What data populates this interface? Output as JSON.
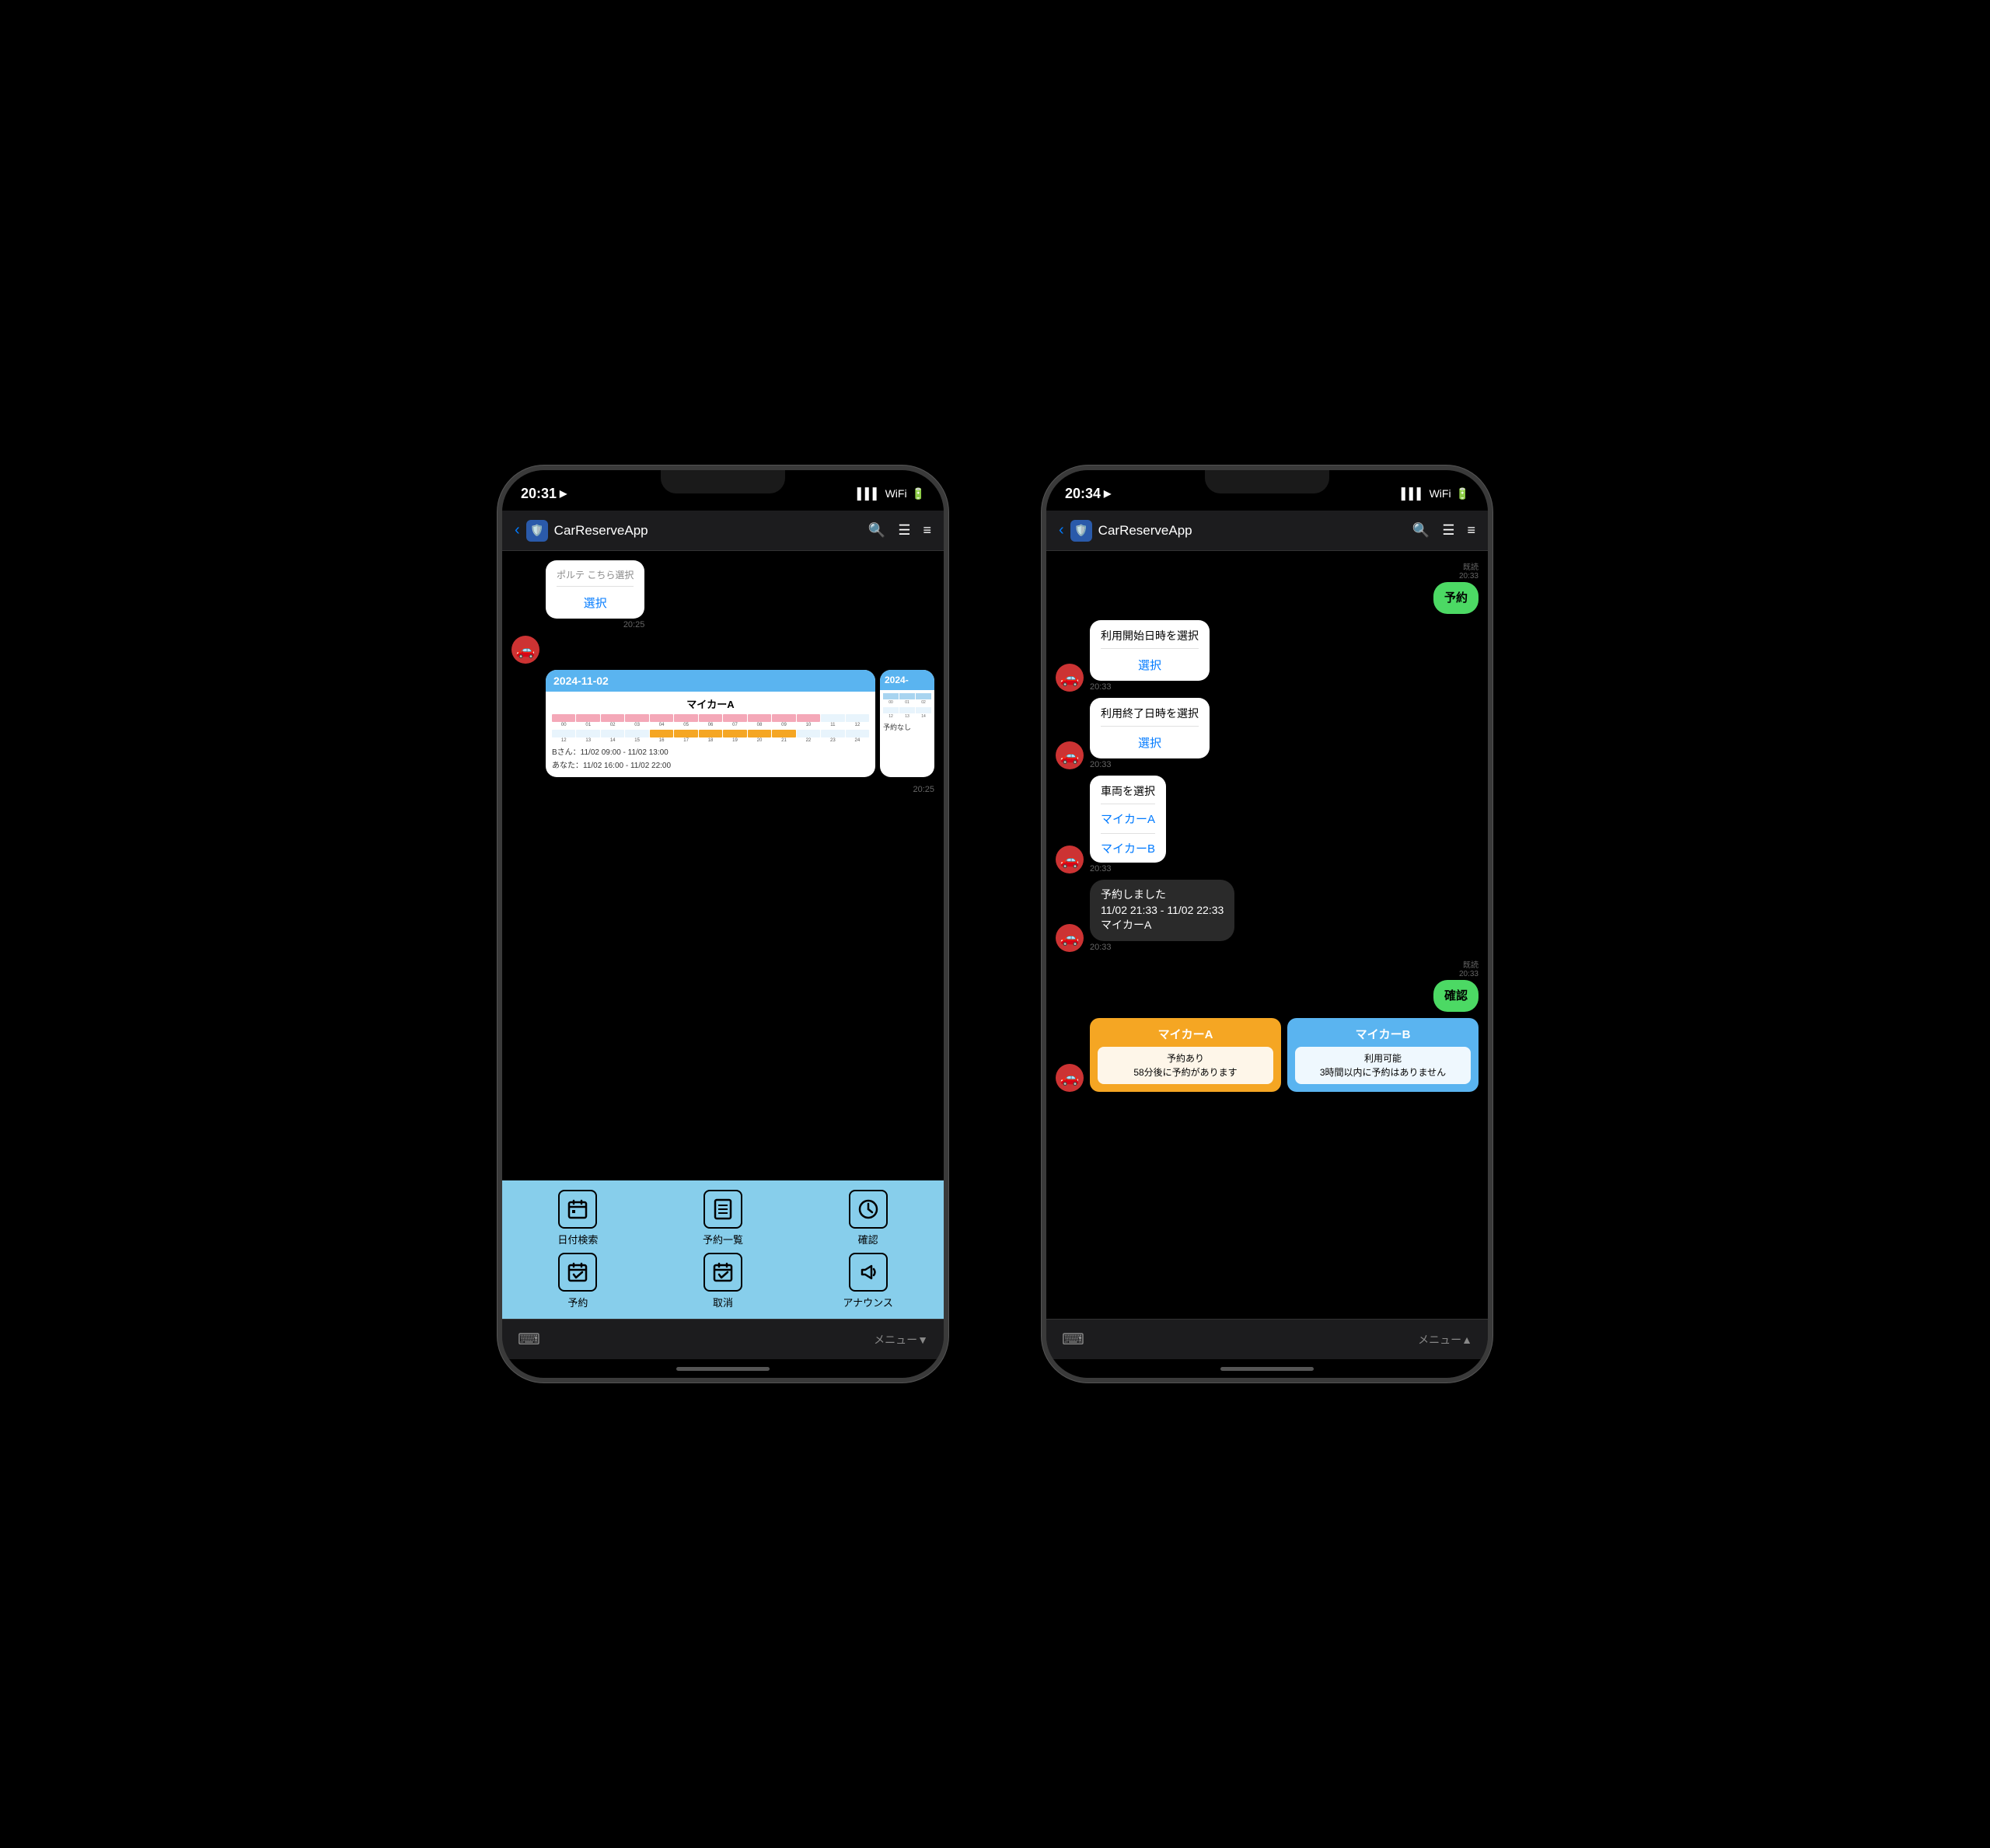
{
  "phone1": {
    "status_time": "20:31",
    "app_title": "CarReserveApp",
    "chat": {
      "select_label": "選択",
      "timestamp1": "20:25",
      "cal_header1": "2024-11-02",
      "cal_header2": "2024-",
      "cal_title": "マイカーA",
      "cal_hours_top": [
        "00",
        "01",
        "02",
        "03",
        "04",
        "05",
        "06",
        "07",
        "08",
        "09",
        "10",
        "11",
        "12"
      ],
      "cal_hours_bot": [
        "12",
        "13",
        "14",
        "15",
        "16",
        "17",
        "18",
        "19",
        "20",
        "21",
        "22",
        "23",
        "24"
      ],
      "cal_info_line1": "Bさん：11/02 09:00 - 11/02 13:00",
      "cal_info_line2": "あなた：11/02 16:00 - 11/02 22:00",
      "no_reservation": "予約なし",
      "timestamp2": "20:25"
    },
    "bottom_menu": {
      "items": [
        {
          "label": "日付検索",
          "icon": "📅"
        },
        {
          "label": "予約一覧",
          "icon": "📋"
        },
        {
          "label": "確認",
          "icon": "🕐"
        },
        {
          "label": "予約",
          "icon": "📅"
        },
        {
          "label": "取消",
          "icon": "📅"
        },
        {
          "label": "アナウンス",
          "icon": "📢"
        }
      ]
    },
    "bottom_bar_menu": "メニュー▼"
  },
  "phone2": {
    "status_time": "20:34",
    "app_title": "CarReserveApp",
    "chat": {
      "yoyaku_label": "予約",
      "timestamp_yoyaku": "20:33",
      "start_date_title": "利用開始日時を選択",
      "start_select_btn": "選択",
      "end_date_title": "利用終了日時を選択",
      "end_select_btn": "選択",
      "car_select_title": "車両を選択",
      "car_option1": "マイカーA",
      "car_option2": "マイカーB",
      "timestamp_card": "20:33",
      "booked_msg_line1": "予約しました",
      "booked_msg_line2": "11/02 21:33 - 11/02 22:33",
      "booked_msg_line3": "マイカーA",
      "timestamp_booked": "20:33",
      "kakunin_label": "確認",
      "timestamp_kakunin": "20:33",
      "car_a_name": "マイカーA",
      "car_a_status_line1": "予約あり",
      "car_a_status_line2": "58分後に予約があります",
      "car_b_name": "マイカーB",
      "car_b_status_line1": "利用可能",
      "car_b_status_line2": "3時間以内に予約はありません"
    },
    "bottom_bar_menu": "メニュー▲"
  },
  "colors": {
    "cal_blue": "#5ab4f0",
    "car_a_orange": "#f5a623",
    "car_b_blue": "#5ab4f0",
    "green_bubble": "#4cd964",
    "link_blue": "#007aff"
  }
}
